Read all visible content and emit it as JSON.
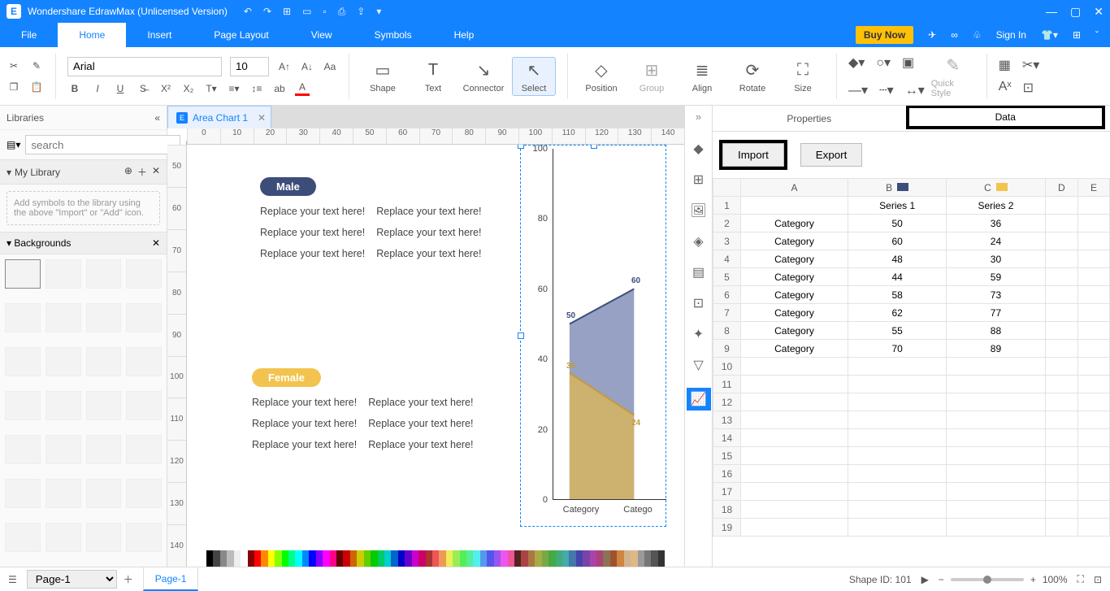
{
  "app": {
    "title": "Wondershare EdrawMax (Unlicensed Version)"
  },
  "menu": {
    "file": "File",
    "home": "Home",
    "insert": "Insert",
    "pagelayout": "Page Layout",
    "view": "View",
    "symbols": "Symbols",
    "help": "Help",
    "buynow": "Buy Now",
    "signin": "Sign In"
  },
  "ribbon": {
    "font": "Arial",
    "size": "10",
    "shape": "Shape",
    "text": "Text",
    "connector": "Connector",
    "select": "Select",
    "position": "Position",
    "group": "Group",
    "align": "Align",
    "rotate": "Rotate",
    "sizebtn": "Size",
    "quickstyle": "Quick Style"
  },
  "leftpanel": {
    "title": "Libraries",
    "search_ph": "search",
    "mylib": "My Library",
    "placeholder": "Add symbols to the library using the above \"Import\" or \"Add\" icon.",
    "backgrounds": "Backgrounds"
  },
  "tabs": {
    "doc1": "Area Chart 1"
  },
  "canvascontent": {
    "male_label": "Male",
    "female_label": "Female",
    "replace": "Replace your text here!"
  },
  "rightpanel": {
    "properties": "Properties",
    "data": "Data",
    "import": "Import",
    "export": "Export",
    "cols": [
      "",
      "A",
      "B",
      "C",
      "D",
      "E"
    ],
    "col_colors": {
      "B": "#3d4d7a",
      "C": "#f2c44f"
    },
    "series_row": {
      "b": "Series 1",
      "c": "Series 2"
    },
    "rows": [
      {
        "n": "2",
        "a": "Category",
        "b": "50",
        "c": "36"
      },
      {
        "n": "3",
        "a": "Category",
        "b": "60",
        "c": "24"
      },
      {
        "n": "4",
        "a": "Category",
        "b": "48",
        "c": "30"
      },
      {
        "n": "5",
        "a": "Category",
        "b": "44",
        "c": "59"
      },
      {
        "n": "6",
        "a": "Category",
        "b": "58",
        "c": "73"
      },
      {
        "n": "7",
        "a": "Category",
        "b": "62",
        "c": "77"
      },
      {
        "n": "8",
        "a": "Category",
        "b": "55",
        "c": "88"
      },
      {
        "n": "9",
        "a": "Category",
        "b": "70",
        "c": "89"
      }
    ],
    "empty_rows": [
      "10",
      "11",
      "12",
      "13",
      "14",
      "15",
      "16",
      "17",
      "18",
      "19"
    ]
  },
  "status": {
    "pagesel": "Page-1",
    "page1": "Page-1",
    "shapeid": "Shape ID: 101",
    "zoom": "100%",
    "plus": "+",
    "minus": "−"
  },
  "hruler": [
    "0",
    "10",
    "20",
    "30",
    "40",
    "50",
    "60",
    "70",
    "80",
    "90",
    "100",
    "110",
    "120",
    "130",
    "140"
  ],
  "vruler": [
    "50",
    "60",
    "70",
    "80",
    "90",
    "100",
    "110",
    "120",
    "130",
    "140"
  ],
  "chart_data": {
    "type": "area",
    "title": "",
    "xlabel": "",
    "ylabel": "",
    "ylim": [
      0,
      100
    ],
    "yticks": [
      0,
      20,
      40,
      60,
      80,
      100
    ],
    "categories": [
      "Category",
      "Category",
      "Category",
      "Category",
      "Category",
      "Category",
      "Category",
      "Category"
    ],
    "visible_x_labels": [
      "Category",
      "Catego"
    ],
    "series": [
      {
        "name": "Series 1",
        "color": "#6776a6",
        "values": [
          50,
          60,
          48,
          44,
          58,
          62,
          55,
          70
        ],
        "visible_point_labels": {
          "0": "50",
          "1": "60"
        }
      },
      {
        "name": "Series 2",
        "color": "#d7b45f",
        "values": [
          36,
          24,
          30,
          59,
          73,
          77,
          88,
          89
        ],
        "visible_point_labels": {
          "0": "36",
          "1": "24"
        }
      }
    ]
  },
  "colorbar_colors": [
    "#000",
    "#444",
    "#888",
    "#bbb",
    "#eee",
    "#fff",
    "#800",
    "#f00",
    "#f80",
    "#ff0",
    "#8f0",
    "#0f0",
    "#0f8",
    "#0ff",
    "#08f",
    "#00f",
    "#80f",
    "#f0f",
    "#f08",
    "#600",
    "#c00",
    "#c60",
    "#cc0",
    "#6c0",
    "#0c0",
    "#0c6",
    "#0cc",
    "#06c",
    "#00c",
    "#60c",
    "#c0c",
    "#c06",
    "#a33",
    "#e55",
    "#e95",
    "#ee5",
    "#9e5",
    "#5e5",
    "#5e9",
    "#5ee",
    "#59e",
    "#55e",
    "#95e",
    "#e5e",
    "#e59",
    "#522",
    "#a44",
    "#a74",
    "#aa4",
    "#7a4",
    "#4a4",
    "#4a7",
    "#4aa",
    "#47a",
    "#44a",
    "#74a",
    "#a4a",
    "#a47",
    "#8b7355",
    "#a0522d",
    "#cd853f",
    "#d2b48c",
    "#deb887",
    "#9a9a9a",
    "#777",
    "#555",
    "#333"
  ]
}
